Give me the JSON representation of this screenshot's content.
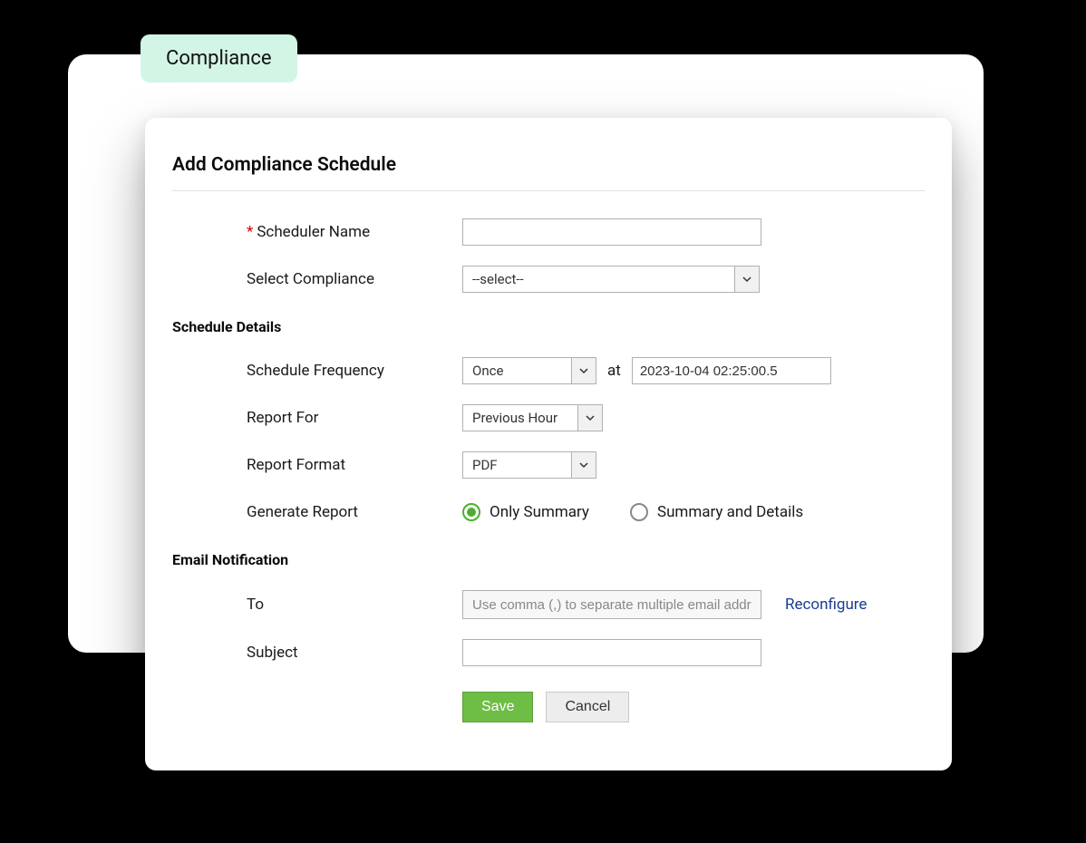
{
  "tab": {
    "label": "Compliance"
  },
  "panel": {
    "title": "Add Compliance Schedule"
  },
  "form": {
    "scheduler_name": {
      "label": "Scheduler Name",
      "value": "",
      "required": true
    },
    "select_compliance": {
      "label": "Select Compliance",
      "value": "--select--"
    }
  },
  "schedule": {
    "heading": "Schedule Details",
    "frequency": {
      "label": "Schedule Frequency",
      "value": "Once",
      "at_label": "at",
      "datetime": "2023-10-04 02:25:00.5"
    },
    "report_for": {
      "label": "Report For",
      "value": "Previous Hour"
    },
    "report_format": {
      "label": "Report Format",
      "value": "PDF"
    },
    "generate_report": {
      "label": "Generate Report",
      "options": {
        "only_summary": "Only Summary",
        "summary_details": "Summary and Details"
      },
      "selected": "only_summary"
    }
  },
  "email": {
    "heading": "Email Notification",
    "to": {
      "label": "To",
      "placeholder": "Use comma (,) to separate multiple email addresses",
      "value": ""
    },
    "reconfigure": "Reconfigure",
    "subject": {
      "label": "Subject",
      "value": ""
    }
  },
  "buttons": {
    "save": "Save",
    "cancel": "Cancel"
  }
}
